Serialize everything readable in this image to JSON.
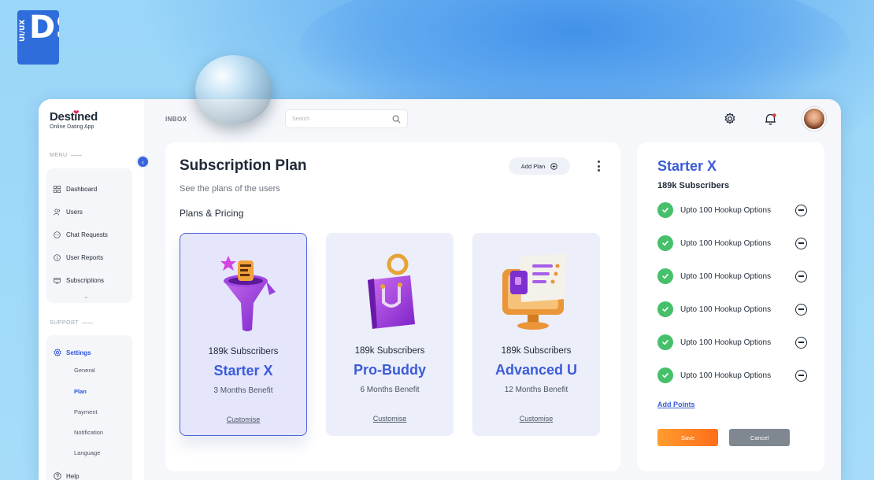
{
  "brand": {
    "badge_small": "UI/UX",
    "badge_big": "DS"
  },
  "app": {
    "name": "Destined",
    "tagline": "Online Dating App"
  },
  "sidebar": {
    "menu_label": "MENU",
    "items": [
      {
        "label": "Dashboard",
        "icon": "grid-icon"
      },
      {
        "label": "Users",
        "icon": "users-icon"
      },
      {
        "label": "Chat Requests",
        "icon": "chat-icon"
      },
      {
        "label": "User Reports",
        "icon": "info-icon"
      },
      {
        "label": "Subscriptions",
        "icon": "subscriptions-icon"
      }
    ],
    "support_label": "SUPPORT",
    "settings": {
      "label": "Settings",
      "sub_items": [
        "General",
        "Plan",
        "Payment",
        "Notification",
        "Language"
      ],
      "active": "Plan"
    },
    "help_label": "Help"
  },
  "topbar": {
    "section": "INBOX",
    "search_placeholder": "Search"
  },
  "main": {
    "title": "Subscription Plan",
    "subtitle": "See the plans of the users",
    "section_title": "Plans & Pricing",
    "add_plan_label": "Add Plan",
    "plans": [
      {
        "subscribers": "189k Subscribers",
        "name": "Starter X",
        "benefit": "3 Months Benefit",
        "action": "Customise",
        "art": "funnel-icon"
      },
      {
        "subscribers": "189k Subscribers",
        "name": "Pro-Buddy",
        "benefit": "6 Months Benefit",
        "action": "Customise",
        "art": "shopping-bag-icon"
      },
      {
        "subscribers": "189k Subscribers",
        "name": "Advanced U",
        "benefit": "12 Months Benefit",
        "action": "Customise",
        "art": "monitor-icon"
      }
    ]
  },
  "details": {
    "title": "Starter X",
    "subscribers": "189k Subscribers",
    "options": [
      "Upto 100 Hookup Options",
      "Upto 100 Hookup Options",
      "Upto 100 Hookup Options",
      "Upto 100 Hookup Options",
      "Upto 100 Hookup Options",
      "Upto 100 Hookup Options"
    ],
    "add_points_label": "Add Points",
    "save_label": "Save",
    "cancel_label": "Cancel"
  },
  "colors": {
    "accent": "#3b5bd9",
    "success": "#46c06a",
    "save": "#ff7f22",
    "cancel": "#7f8791",
    "background": "#8fd0f6"
  }
}
